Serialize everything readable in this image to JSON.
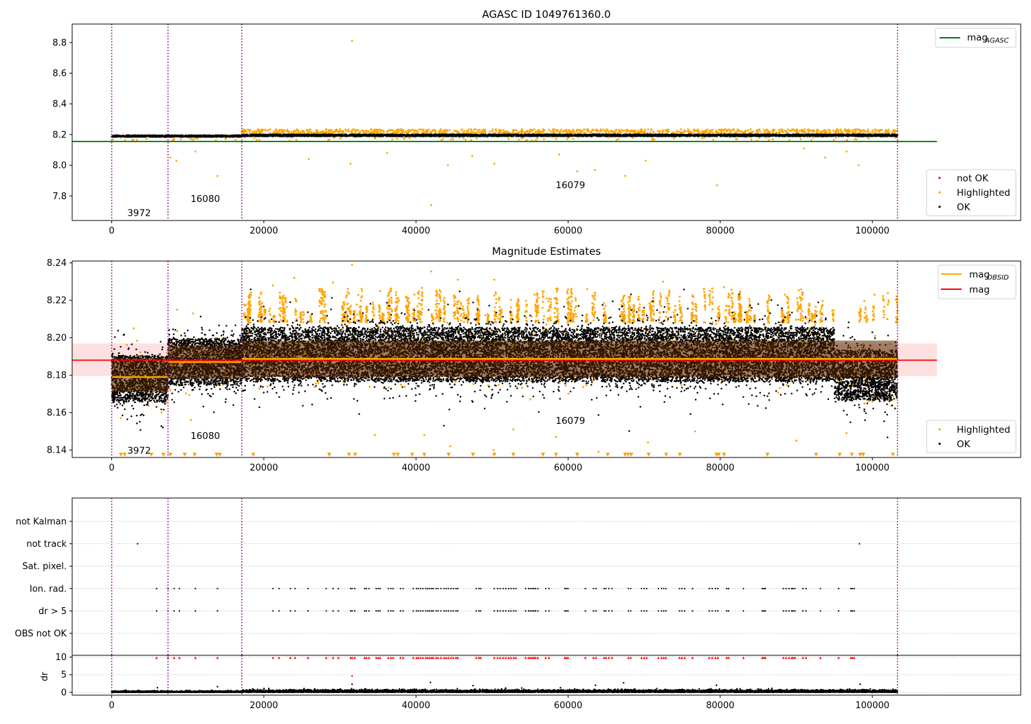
{
  "chart_data": [
    {
      "type": "scatter",
      "title": "AGASC ID 1049761360.0",
      "x_ticks": [
        0,
        20000,
        40000,
        60000,
        80000,
        100000
      ],
      "y_ticks": [
        7.8,
        8.0,
        8.2,
        8.4,
        8.6,
        8.8
      ],
      "xlim": [
        -5200,
        119500
      ],
      "ylim": [
        7.64,
        8.92
      ],
      "obsid_boundaries": [
        0,
        7400,
        17100,
        103300
      ],
      "obsid_labels": [
        {
          "text": "3972",
          "x": 3600,
          "y": 7.67
        },
        {
          "text": "16080",
          "x": 12300,
          "y": 7.76
        },
        {
          "text": "16079",
          "x": 60300,
          "y": 7.85
        }
      ],
      "agasc_mag": 8.155,
      "agasc_line_xrange": [
        -5200,
        108500
      ],
      "legend_lines": [
        {
          "label_main": "mag",
          "label_sub": "AGASC",
          "color": "#008000"
        }
      ],
      "legend_points": [
        {
          "label": "not OK",
          "color": "#ff0000"
        },
        {
          "label": "Highlighted",
          "color": "#ffa500"
        },
        {
          "label": "OK",
          "color": "#000000"
        }
      ],
      "band_segments": [
        {
          "x0": 0,
          "x1": 7400,
          "center": 8.185,
          "half_width": 0.012
        },
        {
          "x0": 7400,
          "x1": 17100,
          "center": 8.187,
          "half_width": 0.012
        },
        {
          "x0": 17100,
          "x1": 103300,
          "center": 8.192,
          "half_width": 0.014
        }
      ],
      "highlighted_points": [
        {
          "x": 31600,
          "y": 8.81
        },
        {
          "x": 42000,
          "y": 7.74
        },
        {
          "x": 79600,
          "y": 7.87
        },
        {
          "x": 13900,
          "y": 7.93
        },
        {
          "x": 67500,
          "y": 7.93
        },
        {
          "x": 61200,
          "y": 7.96
        },
        {
          "x": 63500,
          "y": 7.97
        },
        {
          "x": 98200,
          "y": 8.0
        },
        {
          "x": 31400,
          "y": 8.01
        },
        {
          "x": 44200,
          "y": 8.0
        },
        {
          "x": 50300,
          "y": 8.01
        },
        {
          "x": 70200,
          "y": 8.03
        },
        {
          "x": 8500,
          "y": 8.03
        },
        {
          "x": 25900,
          "y": 8.04
        },
        {
          "x": 7700,
          "y": 8.05
        },
        {
          "x": 36200,
          "y": 8.08
        },
        {
          "x": 58800,
          "y": 8.07
        },
        {
          "x": 93800,
          "y": 8.05
        },
        {
          "x": 47400,
          "y": 8.06
        },
        {
          "x": 11000,
          "y": 8.09
        },
        {
          "x": 96600,
          "y": 8.09
        },
        {
          "x": 91000,
          "y": 8.11
        }
      ],
      "ok_series": [
        {
          "x0": 0,
          "x1": 7400,
          "center": 8.19,
          "spread": 0.012
        },
        {
          "x0": 7400,
          "x1": 17100,
          "center": 8.19,
          "spread": 0.012
        },
        {
          "x0": 17100,
          "x1": 103300,
          "center": 8.195,
          "spread": 0.014
        }
      ]
    },
    {
      "type": "scatter",
      "title": "Magnitude Estimates",
      "x_ticks": [
        0,
        20000,
        40000,
        60000,
        80000,
        100000
      ],
      "y_ticks": [
        8.14,
        8.16,
        8.18,
        8.2,
        8.22,
        8.24
      ],
      "xlim": [
        -5200,
        119500
      ],
      "ylim": [
        8.136,
        8.241
      ],
      "obsid_boundaries": [
        0,
        7400,
        17100,
        103300
      ],
      "obsid_labels": [
        {
          "text": "3972",
          "x": 3600,
          "y": 8.138
        },
        {
          "text": "16080",
          "x": 12300,
          "y": 8.146
        },
        {
          "text": "16079",
          "x": 60300,
          "y": 8.154
        }
      ],
      "mean_mag": 8.188,
      "mean_mag_band": [
        8.1795,
        8.197
      ],
      "mean_line_xrange": [
        -5200,
        108500
      ],
      "obsid_mags": [
        {
          "x0": 0,
          "x1": 7400,
          "mag": 8.179,
          "band": [
            8.171,
            8.189
          ]
        },
        {
          "x0": 7400,
          "x1": 17100,
          "mag": 8.187,
          "band": [
            8.178,
            8.196
          ]
        },
        {
          "x0": 17100,
          "x1": 103300,
          "mag": 8.1887,
          "band": [
            8.179,
            8.1985
          ]
        }
      ],
      "legend_lines": [
        {
          "label_main": "mag",
          "label_sub": "OBSID",
          "color": "#ffa500"
        },
        {
          "label_main": "mag",
          "label_sub": "",
          "color": "#ff0000"
        }
      ],
      "legend_points": [
        {
          "label": "Highlighted",
          "color": "#ffa500"
        },
        {
          "label": "OK",
          "color": "#000000"
        }
      ],
      "ok_series": [
        {
          "x0": 0,
          "x1": 7400,
          "center": 8.178,
          "spread": 0.0125
        },
        {
          "x0": 7400,
          "x1": 17100,
          "center": 8.187,
          "spread": 0.0125
        },
        {
          "x0": 17100,
          "x1": 95000,
          "center": 8.191,
          "spread": 0.0145
        },
        {
          "x0": 95000,
          "x1": 103300,
          "center": 8.18,
          "spread": 0.0135
        }
      ],
      "highlighted_points": [
        {
          "x": 31600,
          "y": 8.239
        },
        {
          "x": 42000,
          "y": 8.2355
        },
        {
          "x": 24000,
          "y": 8.232
        },
        {
          "x": 50300,
          "y": 8.231
        },
        {
          "x": 45500,
          "y": 8.231
        },
        {
          "x": 72500,
          "y": 8.23
        },
        {
          "x": 29100,
          "y": 8.2295
        },
        {
          "x": 21200,
          "y": 8.228
        },
        {
          "x": 62500,
          "y": 8.226
        },
        {
          "x": 80500,
          "y": 8.227
        },
        {
          "x": 35300,
          "y": 8.225
        },
        {
          "x": 39800,
          "y": 8.223
        },
        {
          "x": 55600,
          "y": 8.223
        },
        {
          "x": 67300,
          "y": 8.222
        },
        {
          "x": 88500,
          "y": 8.223
        },
        {
          "x": 100300,
          "y": 8.223
        },
        {
          "x": 57200,
          "y": 8.221
        },
        {
          "x": 8600,
          "y": 8.215
        },
        {
          "x": 10700,
          "y": 8.213
        },
        {
          "x": 2900,
          "y": 8.205
        },
        {
          "x": 34600,
          "y": 8.148
        },
        {
          "x": 41100,
          "y": 8.148
        },
        {
          "x": 52800,
          "y": 8.151
        },
        {
          "x": 58400,
          "y": 8.147
        },
        {
          "x": 70500,
          "y": 8.144
        },
        {
          "x": 76700,
          "y": 8.15
        },
        {
          "x": 96600,
          "y": 8.149
        },
        {
          "x": 10400,
          "y": 8.156
        },
        {
          "x": 1200,
          "y": 8.157
        },
        {
          "x": 50200,
          "y": 8.14
        },
        {
          "x": 64000,
          "y": 8.139
        },
        {
          "x": 44500,
          "y": 8.142
        },
        {
          "x": 90000,
          "y": 8.145
        }
      ],
      "clipped_marker_x": [
        1200,
        1700,
        5200,
        6800,
        7700,
        9600,
        10900,
        13800,
        14200,
        18600,
        28600,
        31200,
        32000,
        37100,
        37600,
        39500,
        41100,
        44300,
        47500,
        50300,
        52800,
        56700,
        58400,
        61200,
        65200,
        67500,
        67900,
        68300,
        70600,
        72900,
        74700,
        79500,
        79800,
        80500,
        86200,
        92600,
        95700,
        97300,
        98400,
        98800,
        102700
      ]
    },
    {
      "type": "scatter",
      "x_ticks": [
        0,
        20000,
        40000,
        60000,
        80000,
        100000
      ],
      "xlim": [
        -5200,
        119500
      ],
      "categories": [
        "not Kalman",
        "not track",
        "Sat. pixel.",
        "Ion. rad.",
        "dr > 5",
        "OBS not OK"
      ],
      "obsid_boundaries": [
        0,
        7400,
        17100,
        103300
      ],
      "flag_points": {
        "not track": [
          3400,
          98300
        ],
        "Ion. rad.": [
          5900,
          7400,
          8200,
          8900,
          11000,
          13900,
          21200,
          22000,
          23500,
          24100,
          25800,
          28200,
          29100,
          29800,
          31400
        ],
        "dr > 5": [
          5900,
          7400,
          8200,
          8900,
          11000,
          13900,
          21200,
          22000,
          23500,
          24100,
          25800,
          28200,
          29100,
          29800,
          31400
        ]
      },
      "flag_dense_range": [
        31400,
        98800
      ]
    },
    {
      "type": "scatter",
      "ylabel": "dr",
      "x_ticks": [
        0,
        20000,
        40000,
        60000,
        80000,
        100000
      ],
      "y_ticks": [
        0,
        5,
        10
      ],
      "xlim": [
        -5200,
        119500
      ],
      "ylim": [
        -0.8,
        10.5
      ],
      "obsid_boundaries": [
        0,
        7400,
        17100,
        103300
      ],
      "clip_value": 9.8,
      "outliers": [
        {
          "x": 31600,
          "y": 4.6,
          "color": "#ff0000"
        },
        {
          "x": 31600,
          "y": 2.3,
          "color": "#000000"
        },
        {
          "x": 41900,
          "y": 2.8,
          "color": "#000000"
        },
        {
          "x": 67300,
          "y": 2.7,
          "color": "#000000"
        },
        {
          "x": 47500,
          "y": 1.9,
          "color": "#000000"
        },
        {
          "x": 63600,
          "y": 2.0,
          "color": "#000000"
        },
        {
          "x": 79500,
          "y": 2.0,
          "color": "#000000"
        },
        {
          "x": 98400,
          "y": 2.3,
          "color": "#000000"
        },
        {
          "x": 6000,
          "y": 1.3,
          "color": "#000000"
        },
        {
          "x": 13900,
          "y": 1.6,
          "color": "#000000"
        },
        {
          "x": 59000,
          "y": 1.3,
          "color": "#000000"
        }
      ]
    }
  ]
}
